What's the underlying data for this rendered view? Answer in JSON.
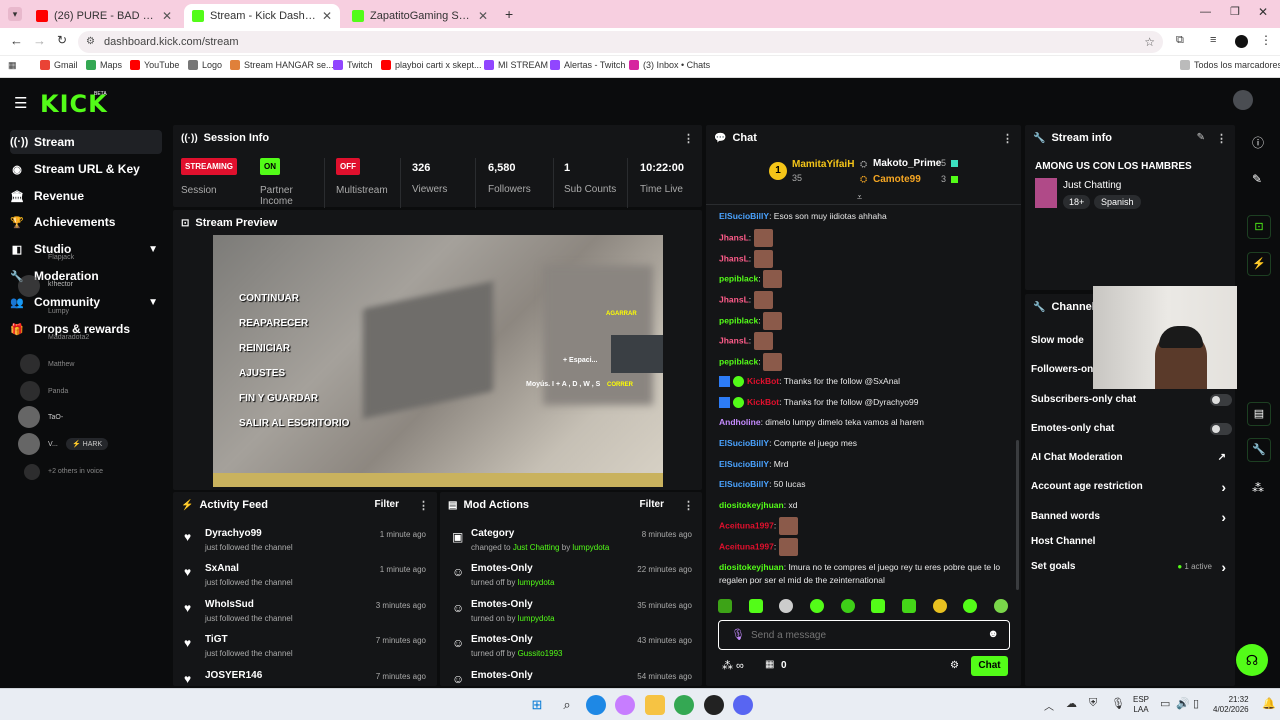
{
  "browser": {
    "tabs": [
      {
        "title": "(26) PURE - BAD BUNNY X FAR...",
        "color": "#ff0000",
        "active": false
      },
      {
        "title": "Stream - Kick Dashboard",
        "color": "#53fc18",
        "active": true
      },
      {
        "title": "ZapatitoGaming Stream - Wat...",
        "color": "#53fc18",
        "active": false
      }
    ],
    "url": "dashboard.kick.com/stream",
    "bookmarks": [
      "Gmail",
      "Maps",
      "YouTube",
      "Logo",
      "Stream HANGAR se...",
      "Twitch",
      "playboi carti x skept...",
      "MI STREAM",
      "Alertas - Twitch",
      "(3) Inbox • Chats"
    ],
    "all_bookmarks": "Todos los marcadores"
  },
  "brand": {
    "logo": "KICK",
    "beta": "BETA",
    "accent": "#53fc18"
  },
  "sidebar": {
    "items": [
      {
        "label": "Stream",
        "icon": "signal-icon"
      },
      {
        "label": "Stream URL & Key",
        "icon": "globe-icon"
      },
      {
        "label": "Revenue",
        "icon": "bank-icon"
      },
      {
        "label": "Achievements",
        "icon": "trophy-icon"
      },
      {
        "label": "Studio",
        "icon": "layers-icon"
      },
      {
        "label": "Moderation",
        "icon": "wrench-icon"
      },
      {
        "label": "Community",
        "icon": "people-icon"
      },
      {
        "label": "Drops & rewards",
        "icon": "gift-icon"
      }
    ],
    "ghost_viewers": [
      "Flapjack",
      "k!hector",
      "Lumpy",
      "Madaradota2",
      "Matthew",
      "Panda",
      "TaO-",
      "V...",
      "HARK",
      "+2 others in voice"
    ]
  },
  "session": {
    "title": "Session Info",
    "stats": [
      {
        "value": "STREAMING",
        "label": "Session",
        "badge": "#e0102d"
      },
      {
        "value": "ON",
        "label": "Partner Income",
        "badge": "#53fc18"
      },
      {
        "value": "OFF",
        "label": "Multistream",
        "badge": "#e0102d"
      },
      {
        "value": "326",
        "label": "Viewers"
      },
      {
        "value": "6,580",
        "label": "Followers"
      },
      {
        "value": "1",
        "label": "Sub Counts"
      },
      {
        "value": "10:22:00",
        "label": "Time Live"
      }
    ]
  },
  "preview": {
    "title": "Stream Preview",
    "menu": [
      "CONTINUAR",
      "REAPARECER",
      "REINICIAR",
      "AJUSTES",
      "FIN Y GUARDAR",
      "SALIR AL ESCRITORIO"
    ],
    "hint": "Moyús. I + A , D , W , S",
    "hint_action": "CORRER",
    "agarrar": "AGARRAR",
    "espacio": "+ Espaci..."
  },
  "activity": {
    "title": "Activity Feed",
    "filter": "Filter",
    "items": [
      {
        "name": "Dyrachyo99",
        "sub": "just followed the channel",
        "time": "1 minute ago"
      },
      {
        "name": "SxAnal",
        "sub": "just followed the channel",
        "time": "1 minute ago"
      },
      {
        "name": "WhoIsSud",
        "sub": "just followed the channel",
        "time": "3 minutes ago"
      },
      {
        "name": "TiGT",
        "sub": "just followed the channel",
        "time": "7 minutes ago"
      },
      {
        "name": "JOSYER146",
        "sub": "",
        "time": "7 minutes ago"
      }
    ]
  },
  "mod": {
    "title": "Mod Actions",
    "filter": "Filter",
    "items": [
      {
        "title": "Category",
        "pre": "changed to ",
        "hl": "Just Chatting",
        "mid": " by ",
        "by": "lumpydota",
        "time": "8 minutes ago"
      },
      {
        "title": "Emotes-Only",
        "pre": "turned off by ",
        "hl": "",
        "mid": "",
        "by": "lumpydota",
        "time": "22 minutes ago"
      },
      {
        "title": "Emotes-Only",
        "pre": "turned on by ",
        "hl": "",
        "mid": "",
        "by": "lumpydota",
        "time": "35 minutes ago"
      },
      {
        "title": "Emotes-Only",
        "pre": "turned off by ",
        "hl": "",
        "mid": "",
        "by": "Gussito1993",
        "time": "43 minutes ago"
      },
      {
        "title": "Emotes-Only",
        "pre": "",
        "hl": "",
        "mid": "",
        "by": "",
        "time": "54 minutes ago"
      }
    ]
  },
  "chat": {
    "title": "Chat",
    "leaders": [
      {
        "rank": "1",
        "name": "MamitaYifaiH",
        "count": "35"
      },
      {
        "rank": "",
        "name": "Makoto_Prime",
        "count": "5"
      },
      {
        "rank": "",
        "name": "Camote99",
        "count": "3"
      }
    ],
    "messages": [
      {
        "user": "ElSucioBillY",
        "color": "#4aa3ff",
        "text": ": Esos son muy iidiotas ahhaha",
        "emote": false
      },
      {
        "user": "JhansL",
        "color": "#ff5c8a",
        "text": ":",
        "emote": true
      },
      {
        "user": "JhansL",
        "color": "#ff5c8a",
        "text": ":",
        "emote": true
      },
      {
        "user": "pepiblack",
        "color": "#53fc18",
        "text": ":",
        "emote": true
      },
      {
        "user": "JhansL",
        "color": "#ff5c8a",
        "text": ":",
        "emote": true
      },
      {
        "user": "pepiblack",
        "color": "#53fc18",
        "text": ":",
        "emote": true
      },
      {
        "user": "JhansL",
        "color": "#ff5c8a",
        "text": ":",
        "emote": true
      },
      {
        "user": "pepiblack",
        "color": "#53fc18",
        "text": ":",
        "emote": true
      },
      {
        "user": "KickBot",
        "color": "#e0102d",
        "text": ": Thanks for the follow @SxAnal",
        "emote": false,
        "bot": true
      },
      {
        "user": "KickBot",
        "color": "#e0102d",
        "text": ": Thanks for the follow @Dyrachyo99",
        "emote": false,
        "bot": true
      },
      {
        "user": "Andholine",
        "color": "#c58bff",
        "text": ": dimelo lumpy dimelo teka vamos al harem",
        "emote": false
      },
      {
        "user": "ElSucioBillY",
        "color": "#4aa3ff",
        "text": ": Comprte el juego mes",
        "emote": false
      },
      {
        "user": "ElSucioBillY",
        "color": "#4aa3ff",
        "text": ": Mrd",
        "emote": false
      },
      {
        "user": "ElSucioBillY",
        "color": "#4aa3ff",
        "text": ": 50 lucas",
        "emote": false
      },
      {
        "user": "diositokeyjhuan",
        "color": "#53fc18",
        "text": ": xd",
        "emote": false
      },
      {
        "user": "Aceituna1997",
        "color": "#e0102d",
        "text": ":",
        "emote": true
      },
      {
        "user": "Aceituna1997",
        "color": "#e0102d",
        "text": ":",
        "emote": true
      },
      {
        "user": "diositokeyjhuan",
        "color": "#53fc18",
        "text": ": Imura no te compres el juego rey tu eres pobre que te lo regalen por ser el mid de the zeinternational",
        "emote": false
      }
    ],
    "placeholder": "Send a message",
    "send": "Chat",
    "points": "0"
  },
  "stream_info": {
    "title": "Stream info",
    "stream_title": "AMONG US CON LOS HAMBRES",
    "category": "Just Chatting",
    "tags": [
      "18+",
      "Spanish"
    ]
  },
  "channel_actions": {
    "title": "Channel Ac...",
    "items": [
      {
        "label": "Slow mode",
        "kind": "toggle"
      },
      {
        "label": "Followers-onl...",
        "kind": "toggle"
      },
      {
        "label": "Subscribers-only chat",
        "kind": "toggle"
      },
      {
        "label": "Emotes-only chat",
        "kind": "toggle"
      },
      {
        "label": "AI Chat Moderation",
        "kind": "link"
      },
      {
        "label": "Account age restriction",
        "kind": "chevron"
      },
      {
        "label": "Banned words",
        "kind": "chevron"
      },
      {
        "label": "Host Channel",
        "kind": "none"
      },
      {
        "label": "Set goals",
        "kind": "chevron",
        "extra": "1 active"
      }
    ]
  },
  "taskbar": {
    "lang1": "ESP",
    "lang2": "LAA",
    "time": "21:32",
    "date": "4/02/2026"
  }
}
